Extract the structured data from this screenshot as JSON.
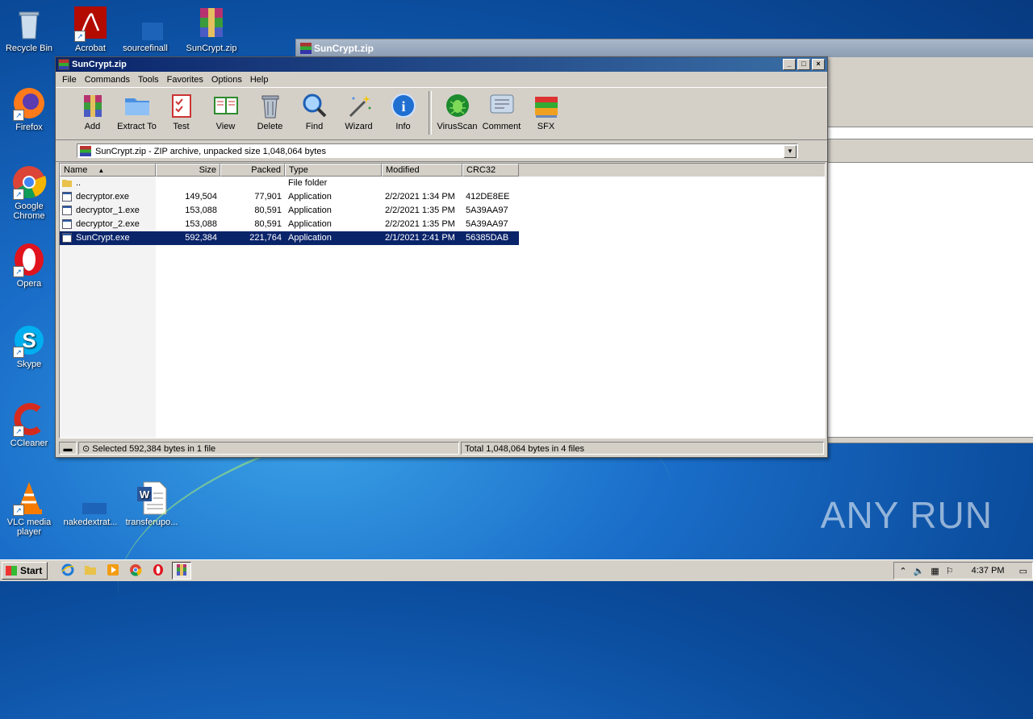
{
  "desktop": {
    "icons": [
      {
        "label": "Recycle Bin"
      },
      {
        "label": "Acrobat"
      },
      {
        "label": "sourcefinall"
      },
      {
        "label": "SunCrypt.zip"
      },
      {
        "label": "Firefox"
      },
      {
        "label": "Google Chrome"
      },
      {
        "label": "Opera"
      },
      {
        "label": "Skype"
      },
      {
        "label": "CCleaner"
      },
      {
        "label": "VLC media player"
      },
      {
        "label": "nakedextrat..."
      },
      {
        "label": "transferupo..."
      }
    ],
    "watermark": "ANY RUN"
  },
  "background_window": {
    "title": "SunCrypt.zip"
  },
  "window": {
    "title": "SunCrypt.zip",
    "menu": [
      "File",
      "Commands",
      "Tools",
      "Favorites",
      "Options",
      "Help"
    ],
    "toolbar": [
      {
        "label": "Add",
        "icon": "add-archive-icon"
      },
      {
        "label": "Extract To",
        "icon": "folder-icon"
      },
      {
        "label": "Test",
        "icon": "checklist-icon"
      },
      {
        "label": "View",
        "icon": "book-icon"
      },
      {
        "label": "Delete",
        "icon": "trash-icon"
      },
      {
        "label": "Find",
        "icon": "magnifier-icon"
      },
      {
        "label": "Wizard",
        "icon": "wand-icon"
      },
      {
        "label": "Info",
        "icon": "info-icon"
      },
      {
        "label": "VirusScan",
        "icon": "bug-icon"
      },
      {
        "label": "Comment",
        "icon": "comment-icon"
      },
      {
        "label": "SFX",
        "icon": "books-icon"
      }
    ],
    "address": "SunCrypt.zip - ZIP archive, unpacked size 1,048,064 bytes",
    "columns": [
      "Name",
      "Size",
      "Packed",
      "Type",
      "Modified",
      "CRC32"
    ],
    "rows": [
      {
        "name": "..",
        "size": "",
        "packed": "",
        "type": "File folder",
        "modified": "",
        "crc": ""
      },
      {
        "name": "decryptor.exe",
        "size": "149,504",
        "packed": "77,901",
        "type": "Application",
        "modified": "2/2/2021 1:34 PM",
        "crc": "412DE8EE"
      },
      {
        "name": "decryptor_1.exe",
        "size": "153,088",
        "packed": "80,591",
        "type": "Application",
        "modified": "2/2/2021 1:35 PM",
        "crc": "5A39AA97"
      },
      {
        "name": "decryptor_2.exe",
        "size": "153,088",
        "packed": "80,591",
        "type": "Application",
        "modified": "2/2/2021 1:35 PM",
        "crc": "5A39AA97"
      },
      {
        "name": "SunCrypt.exe",
        "size": "592,384",
        "packed": "221,764",
        "type": "Application",
        "modified": "2/1/2021 2:41 PM",
        "crc": "56385DAB"
      }
    ],
    "status_left": "Selected 592,384 bytes in 1 file",
    "status_right": "Total 1,048,064 bytes in 4 files"
  },
  "taskbar": {
    "start_label": "Start",
    "clock": "4:37 PM"
  }
}
